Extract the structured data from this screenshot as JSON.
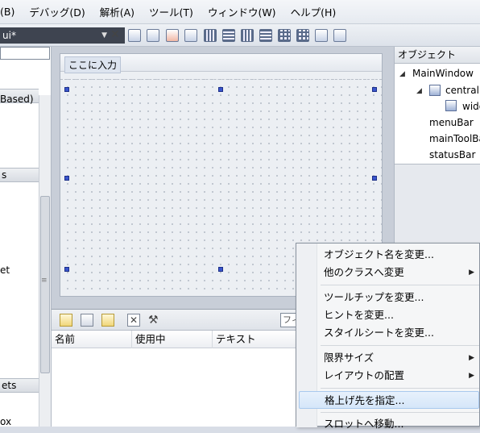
{
  "menubar": {
    "items": [
      "(B)",
      "デバッグ(D)",
      "解析(A)",
      "ツール(T)",
      "ウィンドウ(W)",
      "ヘルプ(H)"
    ]
  },
  "toolbar": {
    "file_tab": "ui*",
    "icons": [
      "edit-widgets-icon",
      "edit-signals-icon",
      "edit-buddies-icon",
      "edit-tab-order-icon",
      "layout-horizontal-icon",
      "layout-vertical-icon",
      "splitter-horizontal-icon",
      "splitter-vertical-icon",
      "layout-grid-icon",
      "form-layout-icon",
      "adjust-size-icon"
    ]
  },
  "widget_box": {
    "items": [
      {
        "kind": "header",
        "text": ""
      },
      {
        "kind": "text",
        "text": "Based)"
      },
      {
        "kind": "header",
        "text": "s"
      },
      {
        "kind": "text",
        "text": "et"
      },
      {
        "kind": "header",
        "text": "ets"
      },
      {
        "kind": "text",
        "text": "ox"
      }
    ]
  },
  "form": {
    "menubar_placeholder": "ここに入力"
  },
  "object_inspector": {
    "title": "オブジェクト",
    "tree": [
      {
        "label": "MainWindow",
        "level": 0,
        "expanded": true
      },
      {
        "label": "central'",
        "level": 1,
        "expanded": true
      },
      {
        "label": "widg",
        "level": 2
      },
      {
        "label": "menuBar",
        "level": 1
      },
      {
        "label": "mainToolBa",
        "level": 1
      },
      {
        "label": "statusBar",
        "level": 1
      }
    ]
  },
  "action_editor": {
    "filter_placeholder": "フィ",
    "columns": [
      "名前",
      "使用中",
      "テキスト"
    ]
  },
  "context_menu": {
    "items": [
      {
        "label": "オブジェクト名を変更...",
        "submenu": false
      },
      {
        "label": "他のクラスへ変更",
        "submenu": true
      },
      {
        "separator": true
      },
      {
        "label": "ツールチップを変更...",
        "submenu": false
      },
      {
        "label": "ヒントを変更...",
        "submenu": false
      },
      {
        "label": "スタイルシートを変更...",
        "submenu": false
      },
      {
        "separator": true
      },
      {
        "label": "限界サイズ",
        "submenu": true
      },
      {
        "label": "レイアウトの配置",
        "submenu": true
      },
      {
        "separator": true
      },
      {
        "label": "格上げ先を指定...",
        "submenu": false,
        "highlighted": true
      },
      {
        "separator": true
      },
      {
        "label": "スロットへ移動...",
        "submenu": false
      }
    ]
  }
}
